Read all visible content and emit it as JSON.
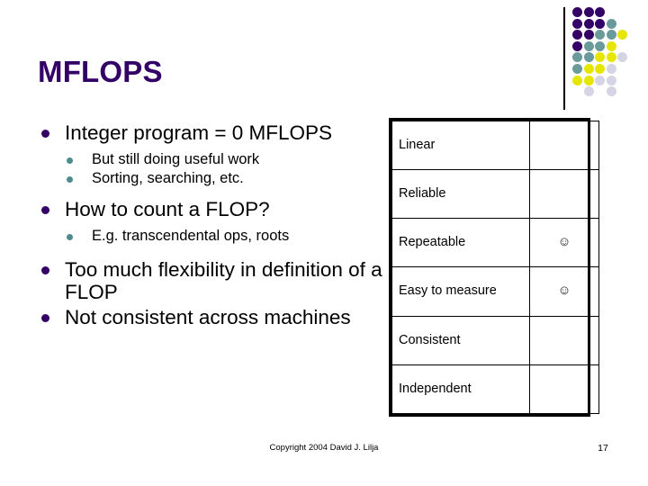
{
  "slide": {
    "title": "MFLOPS",
    "title_color": "#330066",
    "accent_colors": {
      "dark_purple": "#330066",
      "teal": "#4d8c8c",
      "yellow": "#e6e600",
      "lavender": "#ccccdd"
    }
  },
  "bullets": [
    {
      "level": 1,
      "text": "Integer program = 0 MFLOPS",
      "bullet_icon": "disc-bullet-icon"
    },
    {
      "level": 2,
      "text": "But still doing useful work",
      "bullet_icon": "disc-bullet-icon"
    },
    {
      "level": 2,
      "text": "Sorting, searching, etc.",
      "bullet_icon": "disc-bullet-icon"
    },
    {
      "level": 1,
      "text": "How to count a FLOP?",
      "bullet_icon": "disc-bullet-icon"
    },
    {
      "level": 2,
      "text": "E.g. transcendental ops, roots",
      "bullet_icon": "disc-bullet-icon"
    },
    {
      "level": 1,
      "text": "Too much flexibility in definition of a FLOP",
      "bullet_icon": "disc-bullet-icon"
    },
    {
      "level": 1,
      "text": "Not consistent across machines",
      "bullet_icon": "disc-bullet-icon"
    }
  ],
  "criteria_table": {
    "rows": [
      {
        "name": "Linear",
        "mark": ""
      },
      {
        "name": "Reliable",
        "mark": ""
      },
      {
        "name": "Repeatable",
        "mark": "☺"
      },
      {
        "name": "Easy to measure",
        "mark": "☺"
      },
      {
        "name": "Consistent",
        "mark": ""
      },
      {
        "name": "Independent",
        "mark": ""
      }
    ]
  },
  "decoration": {
    "name": "dot-grid-motif",
    "dot_rows": [
      [
        "#330066",
        "#330066",
        "#330066",
        "",
        ""
      ],
      [
        "#330066",
        "#330066",
        "#330066",
        "#6b9a9a",
        ""
      ],
      [
        "#330066",
        "#330066",
        "#6b9a9a",
        "#6b9a9a",
        "#e6e600"
      ],
      [
        "#330066",
        "#6b9a9a",
        "#6b9a9a",
        "#e6e600",
        ""
      ],
      [
        "#6b9a9a",
        "#6b9a9a",
        "#e6e600",
        "#e6e600",
        "#d4d4e4"
      ],
      [
        "#6b9a9a",
        "#e6e600",
        "#e6e600",
        "#d4d4e4",
        ""
      ],
      [
        "#e6e600",
        "#e6e600",
        "#d4d4e4",
        "#d4d4e4",
        ""
      ],
      [
        "",
        "#d4d4e4",
        "",
        "#d4d4e4",
        ""
      ]
    ]
  },
  "footer": {
    "copyright": "Copyright 2004 David J. Lilja",
    "page_number": "17"
  }
}
